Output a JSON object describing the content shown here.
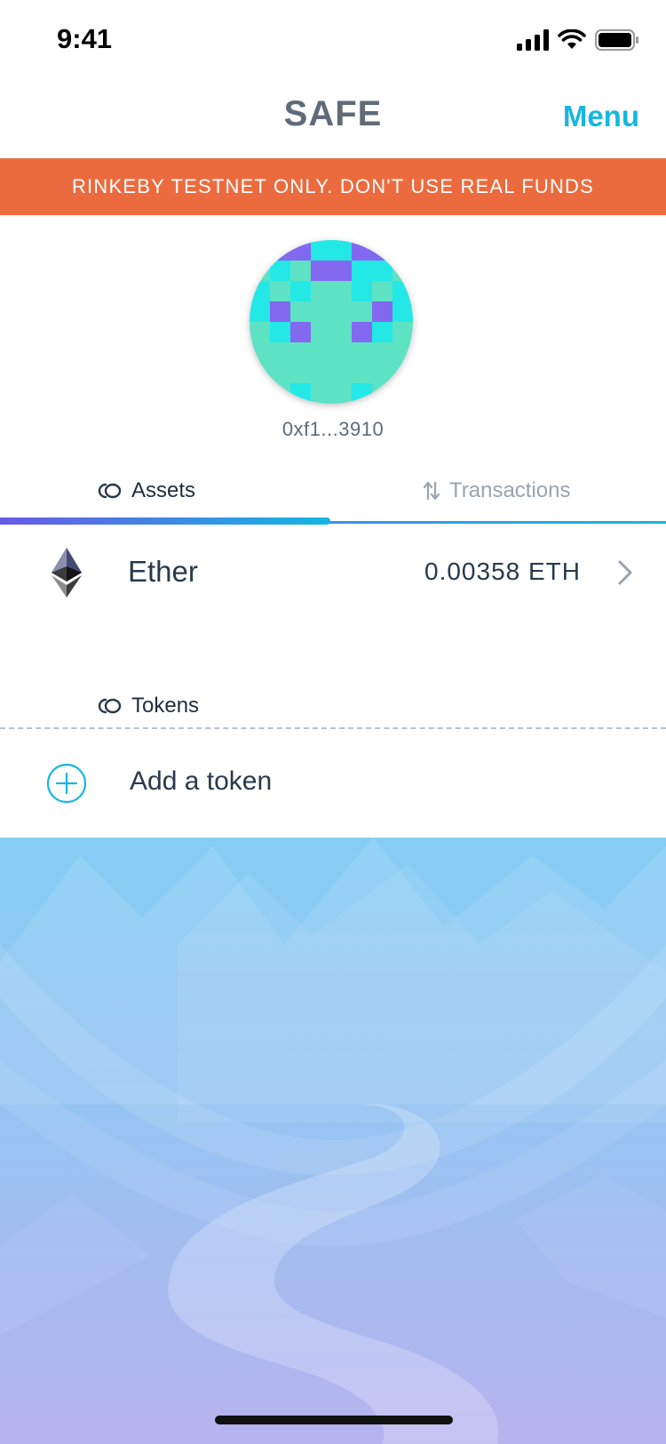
{
  "status_bar": {
    "time": "9:41"
  },
  "navbar": {
    "title": "SAFE",
    "menu_label": "Menu"
  },
  "banner": {
    "text": "RINKEBY TESTNET ONLY. DON'T USE REAL FUNDS",
    "color": "#ec6b3e"
  },
  "safe": {
    "address_short": "0xf1...3910"
  },
  "tabs": [
    {
      "label": "Assets",
      "icon": "coins-icon",
      "selected": true
    },
    {
      "label": "Transactions",
      "icon": "swap-arrows-icon",
      "selected": false
    }
  ],
  "assets": [
    {
      "name": "Ether",
      "balance": "0.00358 ETH",
      "icon": "ethereum-icon"
    }
  ],
  "tokens": {
    "header": "Tokens",
    "add_label": "Add a token"
  },
  "colors": {
    "accent": "#16b7e0",
    "title": "#5f6b7a",
    "text": "#27394d"
  }
}
